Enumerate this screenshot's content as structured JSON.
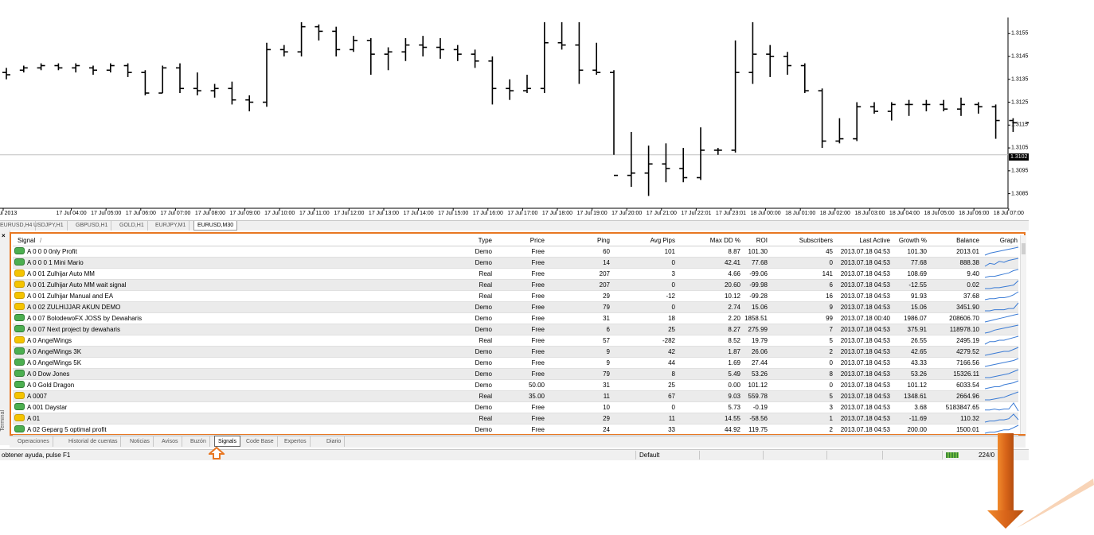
{
  "chart": {
    "symbol": "EURUSD",
    "timeframe": "M30",
    "bars": [
      [
        1.3138,
        1.314,
        1.3135,
        1.3137
      ],
      [
        1.3139,
        1.3141,
        1.3138,
        1.314
      ],
      [
        1.314,
        1.3142,
        1.3139,
        1.3141
      ],
      [
        1.3141,
        1.3142,
        1.3139,
        1.314
      ],
      [
        1.314,
        1.3142,
        1.3138,
        1.3141
      ],
      [
        1.314,
        1.3141,
        1.3137,
        1.3139
      ],
      [
        1.3139,
        1.3142,
        1.3138,
        1.3141
      ],
      [
        1.3141,
        1.3142,
        1.3136,
        1.3138
      ],
      [
        1.3138,
        1.3139,
        1.3128,
        1.3129
      ],
      [
        1.3129,
        1.3141,
        1.3129,
        1.314
      ],
      [
        1.314,
        1.3142,
        1.3129,
        1.3131
      ],
      [
        1.3131,
        1.3138,
        1.3128,
        1.313
      ],
      [
        1.313,
        1.3133,
        1.3127,
        1.3131
      ],
      [
        1.3131,
        1.3134,
        1.3124,
        1.3126
      ],
      [
        1.3126,
        1.3128,
        1.3121,
        1.3125
      ],
      [
        1.3125,
        1.3151,
        1.3123,
        1.3148
      ],
      [
        1.3148,
        1.315,
        1.3145,
        1.3147
      ],
      [
        1.3147,
        1.316,
        1.3145,
        1.3158
      ],
      [
        1.3158,
        1.3159,
        1.3152,
        1.3156
      ],
      [
        1.3156,
        1.3158,
        1.3145,
        1.3148
      ],
      [
        1.3148,
        1.3154,
        1.3147,
        1.3152
      ],
      [
        1.3152,
        1.3153,
        1.3137,
        1.3146
      ],
      [
        1.3146,
        1.3149,
        1.3139,
        1.3147
      ],
      [
        1.3147,
        1.3153,
        1.3143,
        1.315
      ],
      [
        1.315,
        1.3154,
        1.3145,
        1.3149
      ],
      [
        1.3149,
        1.3153,
        1.3144,
        1.3148
      ],
      [
        1.3148,
        1.315,
        1.3143,
        1.3146
      ],
      [
        1.3146,
        1.3148,
        1.314,
        1.3143
      ],
      [
        1.3143,
        1.3145,
        1.3124,
        1.3131
      ],
      [
        1.3131,
        1.3135,
        1.3126,
        1.313
      ],
      [
        1.313,
        1.3137,
        1.3129,
        1.3131
      ],
      [
        1.3131,
        1.316,
        1.3129,
        1.3151
      ],
      [
        1.3151,
        1.316,
        1.3148,
        1.315
      ],
      [
        1.315,
        1.316,
        1.3133,
        1.3139
      ],
      [
        1.3139,
        1.3151,
        1.3137,
        1.3138
      ],
      [
        1.3138,
        1.3139,
        1.3102,
        1.3093
      ],
      [
        1.3093,
        1.3112,
        1.3088,
        1.3094
      ],
      [
        1.3094,
        1.3106,
        1.3084,
        1.3098
      ],
      [
        1.3098,
        1.3107,
        1.309,
        1.3096
      ],
      [
        1.3096,
        1.3105,
        1.309,
        1.3092
      ],
      [
        1.3092,
        1.3114,
        1.3091,
        1.3104
      ],
      [
        1.3104,
        1.3105,
        1.3102,
        1.3104
      ],
      [
        1.3104,
        1.3152,
        1.3103,
        1.3138
      ],
      [
        1.3138,
        1.316,
        1.3133,
        1.3146
      ],
      [
        1.3146,
        1.315,
        1.3136,
        1.3145
      ],
      [
        1.3145,
        1.3147,
        1.3137,
        1.3141
      ],
      [
        1.3141,
        1.3142,
        1.3129,
        1.313
      ],
      [
        1.313,
        1.3131,
        1.3105,
        1.3108
      ],
      [
        1.3108,
        1.3118,
        1.3107,
        1.3109
      ],
      [
        1.3109,
        1.3125,
        1.3108,
        1.3123
      ],
      [
        1.3123,
        1.3125,
        1.312,
        1.3121
      ],
      [
        1.3121,
        1.3125,
        1.3117,
        1.3124
      ],
      [
        1.3124,
        1.3126,
        1.3119,
        1.3124
      ],
      [
        1.3124,
        1.3126,
        1.3121,
        1.3124
      ],
      [
        1.3124,
        1.3126,
        1.3121,
        1.3122
      ],
      [
        1.3122,
        1.3127,
        1.3119,
        1.3124
      ],
      [
        1.3124,
        1.3125,
        1.312,
        1.3123
      ],
      [
        1.3123,
        1.3124,
        1.3109,
        1.3117
      ],
      [
        1.3117,
        1.3118,
        1.3112,
        1.3116
      ],
      [
        1.3116,
        1.3117,
        1.3112,
        1.3116
      ],
      [
        1.3116,
        1.3119,
        1.3112,
        1.3118
      ],
      [
        1.3118,
        1.3119,
        1.3113,
        1.3117
      ],
      [
        1.3117,
        1.3126,
        1.3113,
        1.3117
      ],
      [
        1.3117,
        1.3119,
        1.3114,
        1.3118
      ],
      [
        1.3118,
        1.3119,
        1.3112,
        1.3115
      ],
      [
        1.3115,
        1.3116,
        1.3103,
        1.3107
      ],
      [
        1.3107,
        1.3109,
        1.3104,
        1.3106
      ],
      [
        1.3106,
        1.3109,
        1.3104,
        1.3107
      ],
      [
        1.3107,
        1.3112,
        1.3104,
        1.311
      ],
      [
        1.311,
        1.3111,
        1.3104,
        1.3108
      ],
      [
        1.3108,
        1.311,
        1.3104,
        1.3109
      ],
      [
        1.3109,
        1.311,
        1.3091,
        1.3094
      ],
      [
        1.3094,
        1.3098,
        1.3092,
        1.3095
      ],
      [
        1.3095,
        1.3097,
        1.3091,
        1.3094
      ],
      [
        1.3094,
        1.3098,
        1.3091,
        1.3093
      ],
      [
        1.3093,
        1.3097,
        1.3089,
        1.3091
      ],
      [
        1.3091,
        1.3094,
        1.3089,
        1.3092
      ],
      [
        1.3092,
        1.31,
        1.309,
        1.3098
      ],
      [
        1.3098,
        1.3106,
        1.3091,
        1.3102
      ]
    ],
    "y_min": 1.308,
    "y_max": 1.3161,
    "current_price": "1.3102",
    "price_ticks": [
      "1.3155",
      "1.3145",
      "1.3135",
      "1.3125",
      "1.3115",
      "1.3105",
      "1.3095",
      "1.3085"
    ],
    "time_ticks": [
      "Jul 2013",
      "17 Jul 04:00",
      "17 Jul 05:00",
      "17 Jul 06:00",
      "17 Jul 07:00",
      "17 Jul 08:00",
      "17 Jul 09:00",
      "17 Jul 10:00",
      "17 Jul 11:00",
      "17 Jul 12:00",
      "17 Jul 13:00",
      "17 Jul 14:00",
      "17 Jul 15:00",
      "17 Jul 16:00",
      "17 Jul 17:00",
      "17 Jul 18:00",
      "17 Jul 19:00",
      "17 Jul 20:00",
      "17 Jul 21:00",
      "17 Jul 22:01",
      "17 Jul 23:01",
      "18 Jul 00:00",
      "18 Jul 01:00",
      "18 Jul 02:00",
      "18 Jul 03:00",
      "18 Jul 04:00",
      "18 Jul 05:00",
      "18 Jul 06:00",
      "18 Jul 07:00"
    ],
    "tabs": [
      "EURUSD,H4",
      "USDJPY,H1",
      "GBPUSD,H1",
      "GOLD,H1",
      "EURJPY,M1",
      "EURUSD,M30"
    ],
    "active_tab": "EURUSD,M30"
  },
  "terminal": {
    "side_label": "Terminal",
    "close_glyph": "×",
    "columns": {
      "signal": "Signal",
      "sort": "/",
      "type": "Type",
      "price": "Price",
      "ping": "Ping",
      "avg_pips": "Avg Pips",
      "max_dd": "Max DD %",
      "roi": "ROI",
      "subscribers": "Subscribers",
      "last_active": "Last Active",
      "growth": "Growth %",
      "balance": "Balance",
      "graph": "Graph"
    },
    "rows": [
      {
        "icon": "green",
        "signal": "A 0 0 0 0nly Profit",
        "type": "Demo",
        "price": "Free",
        "ping": "60",
        "avg_pips": "101",
        "max_dd": "8.87",
        "roi": "101.30",
        "subscribers": "45",
        "last_active": "2013.07.18 04:53",
        "growth": "101.30",
        "balance": "2013.01",
        "graph": [
          1,
          3,
          4,
          5,
          6,
          7,
          8,
          9
        ]
      },
      {
        "icon": "green",
        "signal": "A 0 0 0 1 Mini Mario",
        "type": "Demo",
        "price": "Free",
        "ping": "14",
        "avg_pips": "0",
        "max_dd": "42.41",
        "roi": "77.68",
        "subscribers": "0",
        "last_active": "2013.07.18 04:53",
        "growth": "77.68",
        "balance": "888.38",
        "graph": [
          1,
          4,
          3,
          6,
          5,
          7,
          8,
          9
        ]
      },
      {
        "icon": "yellow",
        "signal": "A 0 01 Zulhijar Auto MM",
        "type": "Real",
        "price": "Free",
        "ping": "207",
        "avg_pips": "3",
        "max_dd": "4.66",
        "roi": "-99.06",
        "subscribers": "141",
        "last_active": "2013.07.18 04:53",
        "growth": "108.69",
        "balance": "9.40",
        "graph": [
          2,
          3,
          3,
          4,
          5,
          6,
          8,
          9
        ]
      },
      {
        "icon": "yellow",
        "signal": "A 0 01 Zulhijar Auto MM wait signal",
        "type": "Real",
        "price": "Free",
        "ping": "207",
        "avg_pips": "0",
        "max_dd": "20.60",
        "roi": "-99.98",
        "subscribers": "6",
        "last_active": "2013.07.18 04:53",
        "growth": "-12.55",
        "balance": "0.02",
        "graph": [
          1,
          1,
          2,
          2,
          3,
          4,
          5,
          10
        ]
      },
      {
        "icon": "yellow",
        "signal": "A 0 01 Zulhijar Manual and EA",
        "type": "Real",
        "price": "Free",
        "ping": "29",
        "avg_pips": "-12",
        "max_dd": "10.12",
        "roi": "-99.28",
        "subscribers": "16",
        "last_active": "2013.07.18 04:53",
        "growth": "91.93",
        "balance": "37.68",
        "graph": [
          1,
          2,
          2,
          3,
          3,
          4,
          6,
          9
        ]
      },
      {
        "icon": "yellow",
        "signal": "A 0 02 ZULHIJJAR AKUN DEMO",
        "type": "Demo",
        "price": "Free",
        "ping": "79",
        "avg_pips": "0",
        "max_dd": "2.74",
        "roi": "15.06",
        "subscribers": "9",
        "last_active": "2013.07.18 04:53",
        "growth": "15.06",
        "balance": "3451.90",
        "graph": [
          1,
          1,
          2,
          2,
          2,
          3,
          3,
          8
        ]
      },
      {
        "icon": "green",
        "signal": "A 0 07 BolodewoFX JOSS by Dewaharis",
        "type": "Demo",
        "price": "Free",
        "ping": "31",
        "avg_pips": "18",
        "max_dd": "2.20",
        "roi": "1858.51",
        "subscribers": "99",
        "last_active": "2013.07.18 00:40",
        "growth": "1986.07",
        "balance": "208606.70",
        "graph": [
          1,
          2,
          3,
          4,
          5,
          6,
          7,
          8
        ]
      },
      {
        "icon": "green",
        "signal": "A 0 07 Next project by dewaharis",
        "type": "Demo",
        "price": "Free",
        "ping": "6",
        "avg_pips": "25",
        "max_dd": "8.27",
        "roi": "275.99",
        "subscribers": "7",
        "last_active": "2013.07.18 04:53",
        "growth": "375.91",
        "balance": "118978.10",
        "graph": [
          1,
          2,
          4,
          5,
          6,
          7,
          8,
          9
        ]
      },
      {
        "icon": "yellow",
        "signal": "A 0 AngelWings",
        "type": "Real",
        "price": "Free",
        "ping": "57",
        "avg_pips": "-282",
        "max_dd": "8.52",
        "roi": "19.79",
        "subscribers": "5",
        "last_active": "2013.07.18 04:53",
        "growth": "26.55",
        "balance": "2495.19",
        "graph": [
          1,
          3,
          3,
          4,
          4,
          5,
          6,
          7
        ]
      },
      {
        "icon": "green",
        "signal": "A 0 AngelWings 3K",
        "type": "Demo",
        "price": "Free",
        "ping": "9",
        "avg_pips": "42",
        "max_dd": "1.87",
        "roi": "26.06",
        "subscribers": "2",
        "last_active": "2013.07.18 04:53",
        "growth": "42.65",
        "balance": "4279.52",
        "graph": [
          1,
          2,
          3,
          4,
          5,
          5,
          7,
          9
        ]
      },
      {
        "icon": "green",
        "signal": "A 0 AngelWings 5K",
        "type": "Demo",
        "price": "Free",
        "ping": "9",
        "avg_pips": "44",
        "max_dd": "1.69",
        "roi": "27.44",
        "subscribers": "0",
        "last_active": "2013.07.18 04:53",
        "growth": "43.33",
        "balance": "7166.56",
        "graph": [
          1,
          2,
          3,
          4,
          5,
          6,
          7,
          9
        ]
      },
      {
        "icon": "green",
        "signal": "A 0 Dow Jones",
        "type": "Demo",
        "price": "Free",
        "ping": "79",
        "avg_pips": "8",
        "max_dd": "5.49",
        "roi": "53.26",
        "subscribers": "8",
        "last_active": "2013.07.18 04:53",
        "growth": "53.26",
        "balance": "15326.11",
        "graph": [
          1,
          1,
          2,
          3,
          4,
          5,
          7,
          9
        ]
      },
      {
        "icon": "green",
        "signal": "A 0 Gold Dragon",
        "type": "Demo",
        "price": "50.00",
        "ping": "31",
        "avg_pips": "25",
        "max_dd": "0.00",
        "roi": "101.12",
        "subscribers": "0",
        "last_active": "2013.07.18 04:53",
        "growth": "101.12",
        "balance": "6033.54",
        "graph": [
          1,
          2,
          3,
          3,
          5,
          6,
          7,
          9
        ]
      },
      {
        "icon": "yellow",
        "signal": "A 0007",
        "type": "Real",
        "price": "35.00",
        "ping": "11",
        "avg_pips": "67",
        "max_dd": "9.03",
        "roi": "559.78",
        "subscribers": "5",
        "last_active": "2013.07.18 04:53",
        "growth": "1348.61",
        "balance": "2664.96",
        "graph": [
          1,
          1,
          2,
          3,
          4,
          6,
          8,
          10
        ]
      },
      {
        "icon": "green",
        "signal": "A 001 Daystar",
        "type": "Demo",
        "price": "Free",
        "ping": "10",
        "avg_pips": "0",
        "max_dd": "5.73",
        "roi": "-0.19",
        "subscribers": "3",
        "last_active": "2013.07.18 04:53",
        "growth": "3.68",
        "balance": "5183847.65",
        "graph": [
          3,
          3,
          4,
          3,
          4,
          4,
          10,
          2
        ]
      },
      {
        "icon": "yellow",
        "signal": "A 01",
        "type": "Real",
        "price": "Free",
        "ping": "29",
        "avg_pips": "11",
        "max_dd": "14.55",
        "roi": "-58.56",
        "subscribers": "1",
        "last_active": "2013.07.18 04:53",
        "growth": "-11.69",
        "balance": "110.32",
        "graph": [
          2,
          3,
          3,
          4,
          4,
          5,
          9,
          4
        ]
      },
      {
        "icon": "green",
        "signal": "A 02 Geparg 5 optimal profit",
        "type": "Demo",
        "price": "Free",
        "ping": "24",
        "avg_pips": "33",
        "max_dd": "44.92",
        "roi": "119.75",
        "subscribers": "2",
        "last_active": "2013.07.18 04:53",
        "growth": "200.00",
        "balance": "1500.01",
        "graph": [
          1,
          2,
          2,
          3,
          4,
          4,
          6,
          8
        ]
      }
    ],
    "bottom_tabs": [
      "Operaciones",
      "Historial de cuentas",
      "Noticias",
      "Avisos",
      "Buzón",
      "Signals",
      "Code Base",
      "Expertos",
      "Diario"
    ],
    "active_bottom_tab": "Signals"
  },
  "statusbar": {
    "help": "obtener ayuda, pulse F1",
    "profile": "Default",
    "traffic": "224/0"
  },
  "colors": {
    "highlight": "#e87722",
    "sparkline": "#3a7bd5",
    "alt_row": "#ebebeb"
  }
}
